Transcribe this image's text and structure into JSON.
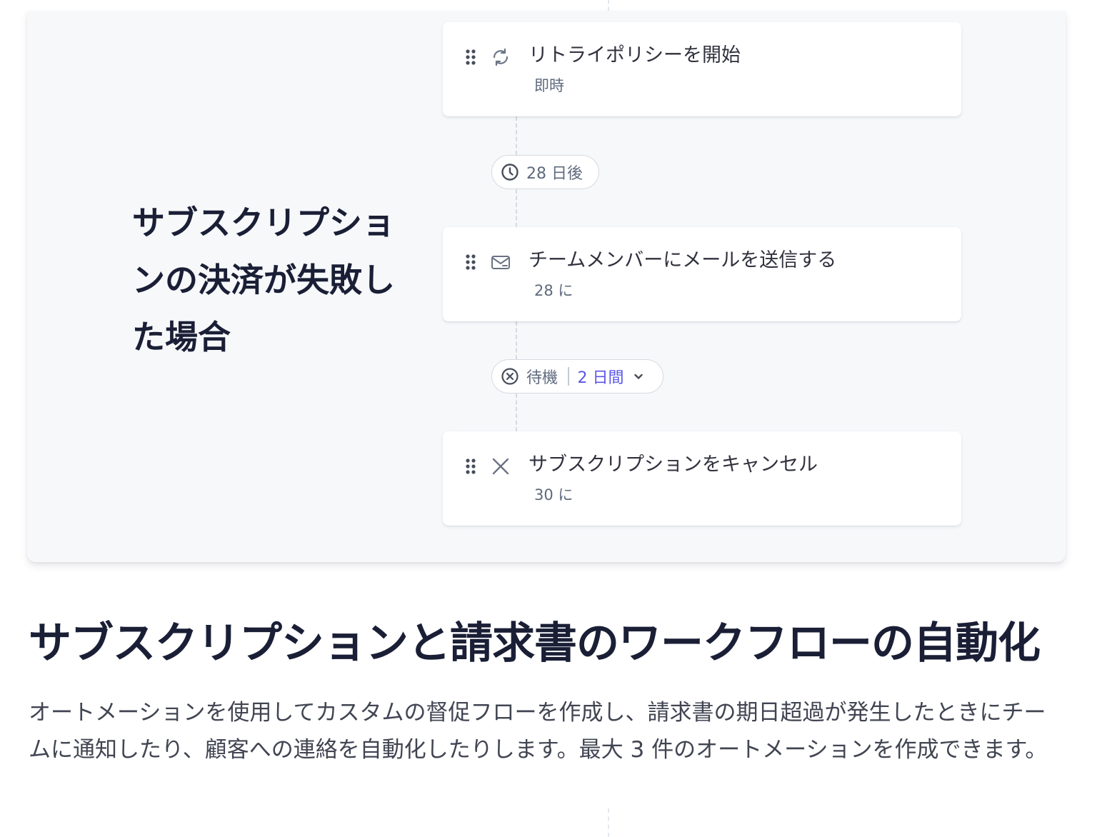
{
  "scenario": {
    "title": "サブスクリプションの決済が失敗した場合"
  },
  "steps": [
    {
      "title": "リトライポリシーを開始",
      "subtitle": "即時",
      "icon": "refresh-icon"
    },
    {
      "title": "チームメンバーにメールを送信する",
      "subtitle": "28 に",
      "icon": "mail-icon"
    },
    {
      "title": "サブスクリプションをキャンセル",
      "subtitle": "30 に",
      "icon": "close-icon"
    }
  ],
  "delays": {
    "first": {
      "label": "28 日後",
      "icon": "clock-icon"
    },
    "second": {
      "label": "待機",
      "value": "2 日間",
      "icon": "cancel-circle-icon"
    }
  },
  "section": {
    "heading": "サブスクリプションと請求書のワークフローの自動化",
    "description": "オートメーションを使用してカスタムの督促フローを作成し、請求書の期日超過が発生したときにチームに通知したり、顧客への連絡を自動化したりします。最大 3 件のオートメーションを作成できます。"
  },
  "colors": {
    "panel_bg": "#f6f8fa",
    "accent": "#5a55e8",
    "text_dark": "#1a1f36",
    "text_muted": "#5e6a7d"
  }
}
